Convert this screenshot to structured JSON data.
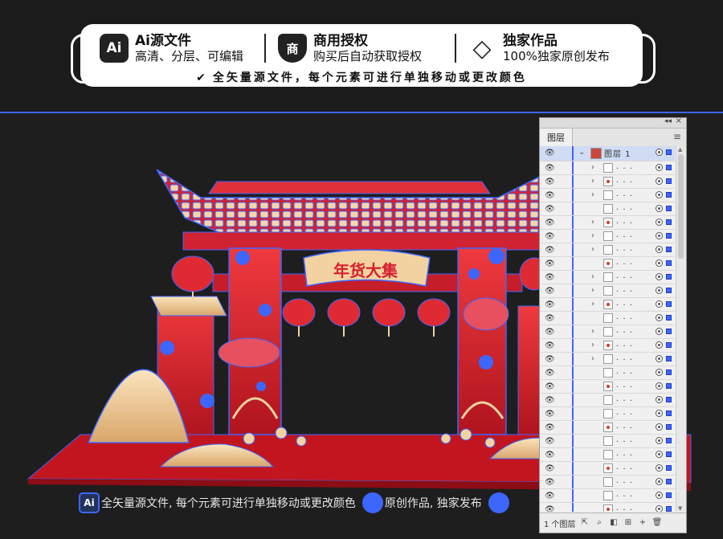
{
  "banner": {
    "features": [
      {
        "icon": "ai-file-icon",
        "icon_text": "Ai",
        "title": "Ai源文件",
        "subtitle": "高清、分层、可编辑"
      },
      {
        "icon": "commercial-shield-icon",
        "icon_text": "商",
        "title": "商用授权",
        "subtitle": "购买后自动获取授权"
      },
      {
        "icon": "diamond-icon",
        "icon_text": "◇",
        "title": "独家作品",
        "subtitle": "100%独家原创发布"
      }
    ],
    "tagline": "全矢量源文件，每个元素可进行单独移动或更改颜色",
    "check_glyph": "✔"
  },
  "artwork": {
    "sign_text": "年货大集",
    "colors": {
      "red": "#d5202e",
      "dark_red": "#a5121c",
      "gold": "#f2d2a0",
      "roof_blue": "#3d66ff",
      "floor": "#c3151f"
    }
  },
  "caption": {
    "ai_badge": "Ai",
    "text1": "全矢量源文件, 每个元素可进行单独移动或更改颜色",
    "text2": "原创作品, 独家发布"
  },
  "layers_panel": {
    "collapse_glyph": "◂◂",
    "close_glyph": "×",
    "tab_label": "图层",
    "menu_glyph": "≡",
    "top_layer": {
      "name": "图层 1",
      "expanded": true
    },
    "sublayer_placeholder": ". . .",
    "sublayer_count": 27,
    "footer_count": "1 个图层",
    "footer_icons": [
      "export-icon",
      "search-icon",
      "clip-mask-icon",
      "new-sublayer-icon",
      "new-layer-icon",
      "delete-icon"
    ]
  }
}
